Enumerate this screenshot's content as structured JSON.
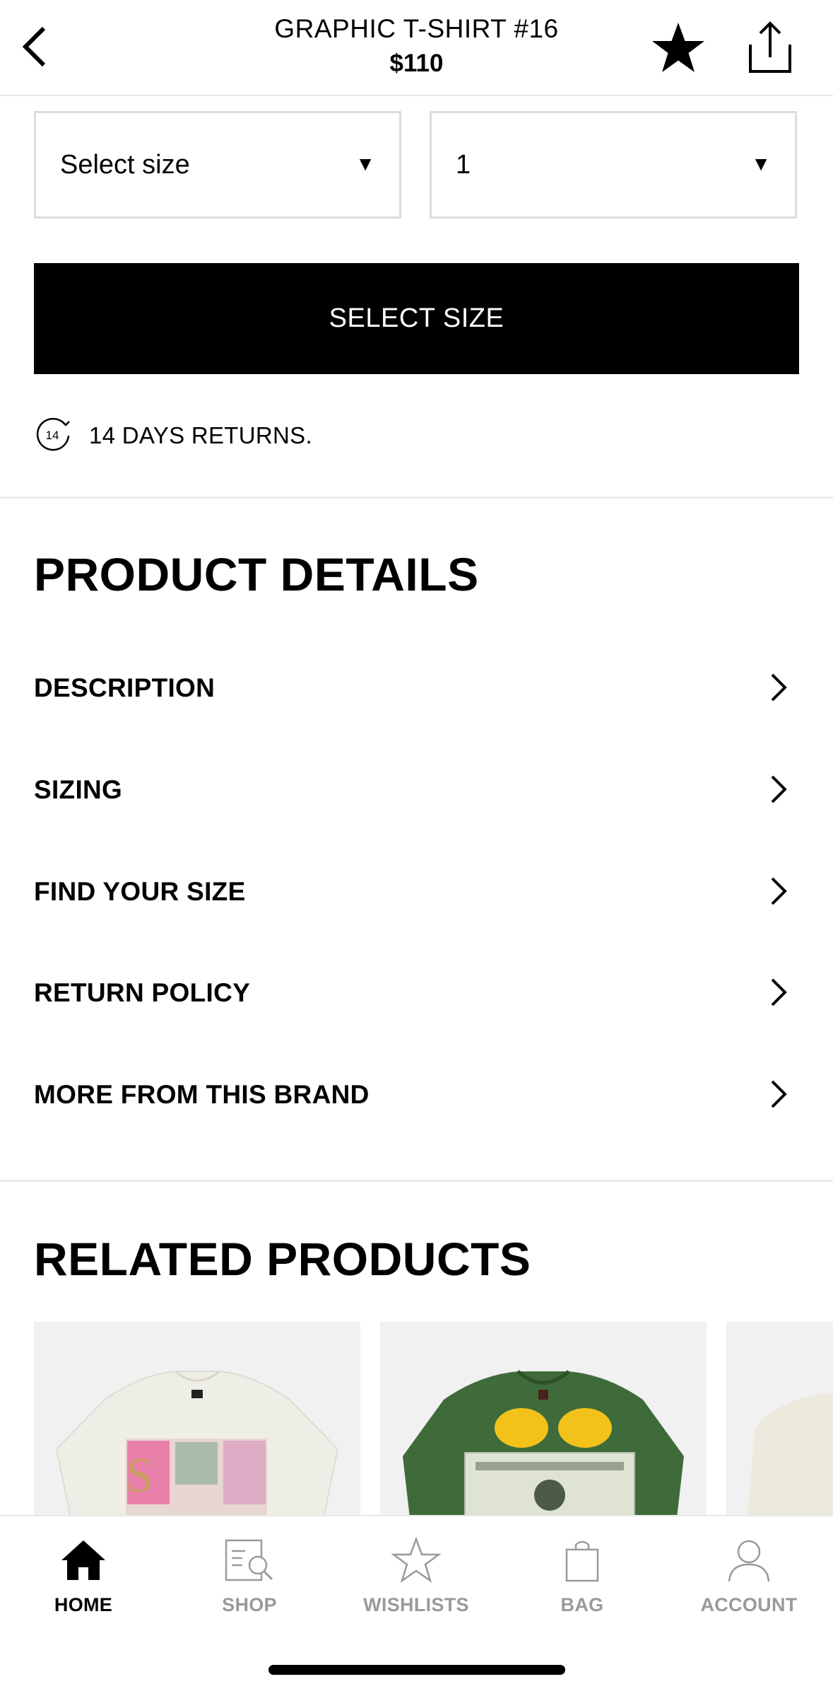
{
  "header": {
    "title": "GRAPHIC T-SHIRT #16",
    "price": "$110",
    "icons": {
      "back": "chevron-left-icon",
      "favorite": "star-filled-icon",
      "share": "share-icon"
    }
  },
  "selectors": {
    "size": {
      "value": "Select size",
      "icon": "triangle-down-icon"
    },
    "quantity": {
      "value": "1",
      "icon": "triangle-down-icon"
    }
  },
  "cta": {
    "label": "SELECT SIZE"
  },
  "returns": {
    "icon_text": "14",
    "text": "14 DAYS RETURNS."
  },
  "product_details": {
    "title": "PRODUCT DETAILS",
    "items": [
      {
        "label": "DESCRIPTION"
      },
      {
        "label": "SIZING"
      },
      {
        "label": "FIND YOUR SIZE"
      },
      {
        "label": "RETURN POLICY"
      },
      {
        "label": "MORE FROM THIS BRAND"
      }
    ]
  },
  "related": {
    "title": "RELATED PRODUCTS"
  },
  "tabbar": {
    "tabs": [
      {
        "label": "HOME",
        "icon": "home-icon",
        "active": true
      },
      {
        "label": "SHOP",
        "icon": "shop-search-icon",
        "active": false
      },
      {
        "label": "WISHLISTS",
        "icon": "star-outline-icon",
        "active": false
      },
      {
        "label": "BAG",
        "icon": "bag-icon",
        "active": false
      },
      {
        "label": "ACCOUNT",
        "icon": "account-icon",
        "active": false
      }
    ]
  },
  "colors": {
    "primary": "#000000",
    "inactive": "#9a9a9a",
    "border": "#dcdcdc",
    "card_bg": "#f1f1f1",
    "shirt_green": "#3f6b3a",
    "shirt_cream": "#efeee6"
  }
}
